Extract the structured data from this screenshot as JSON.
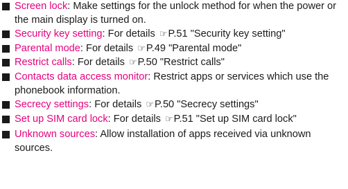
{
  "colors": {
    "term": "#e5007e",
    "text": "#1a1a1a",
    "bullet": "#1a1a1a"
  },
  "ref_icon": "reference-hand-icon",
  "items": [
    {
      "term": "Screen lock",
      "sep": ": ",
      "text": "Make settings for the unlock method for when the power or the main display is turned on."
    },
    {
      "term": "Security key setting",
      "sep": ": ",
      "pre": "For details ",
      "ref_symbol": "☞",
      "ref": "P.51 \"Security key setting\""
    },
    {
      "term": "Parental mode",
      "sep": ": ",
      "pre": "For details ",
      "ref_symbol": "☞",
      "ref": "P.49 \"Parental mode\""
    },
    {
      "term": "Restrict calls",
      "sep": ": ",
      "pre": "For details ",
      "ref_symbol": "☞",
      "ref": "P.50 \"Restrict calls\""
    },
    {
      "term": "Contacts data access monitor",
      "sep": ": ",
      "text": "Restrict apps or services which use the phonebook information."
    },
    {
      "term": "Secrecy settings",
      "sep": ": ",
      "pre": "For details ",
      "ref_symbol": "☞",
      "ref": "P.50 \"Secrecy settings\""
    },
    {
      "term": "Set up SIM card lock",
      "sep": ": ",
      "pre": "For details ",
      "ref_symbol": "☞",
      "ref": "P.51 \"Set up SIM card lock\""
    },
    {
      "term": "Unknown sources",
      "sep": ": ",
      "text": "Allow installation of apps received via unknown sources."
    }
  ]
}
